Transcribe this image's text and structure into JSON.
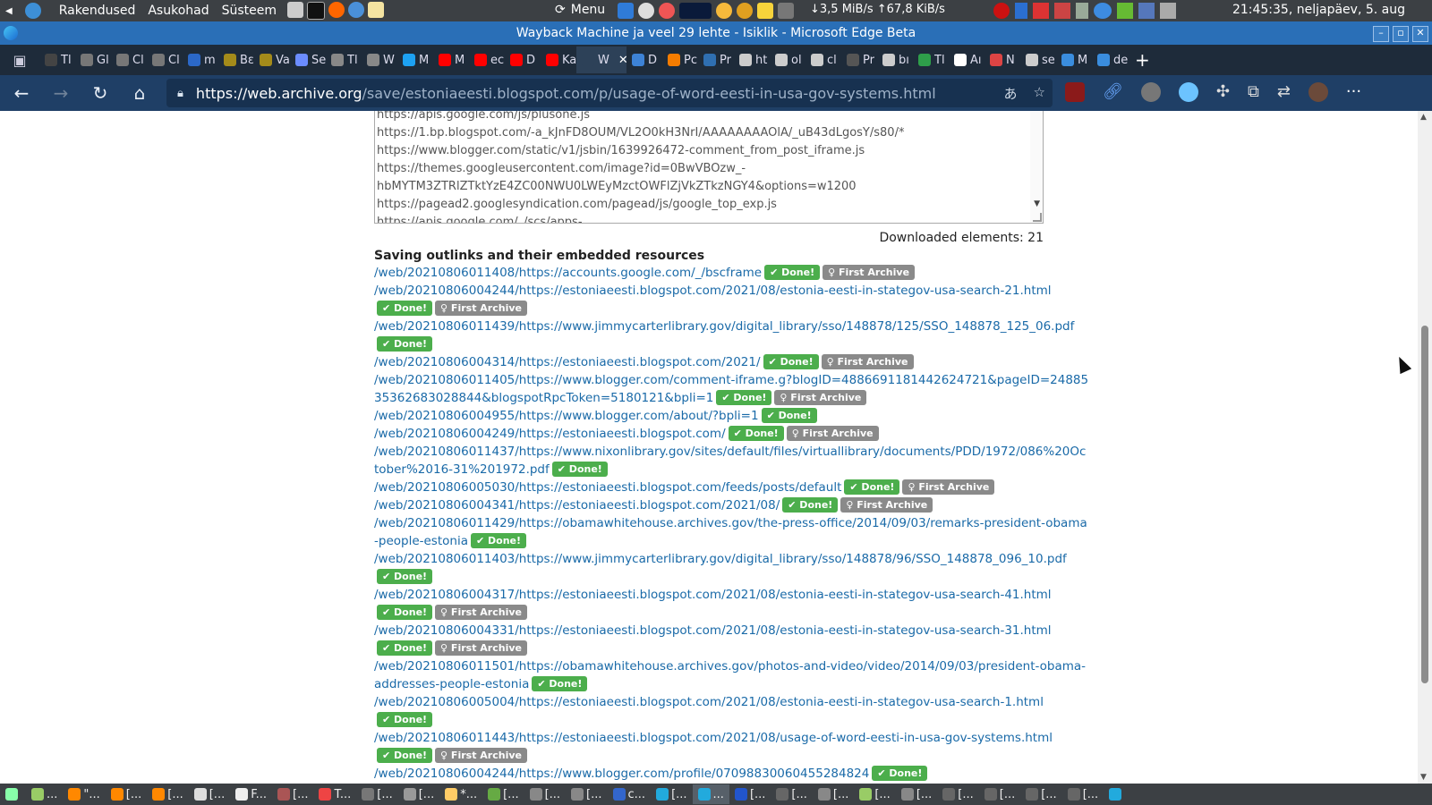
{
  "system_panel": {
    "menus": [
      "Rakendused",
      "Asukohad",
      "Süsteem"
    ],
    "menu_button": "Menu",
    "network_down": "3,5 MiB/s",
    "network_up": "67,8 KiB/s",
    "clock": "21:45:35, neljapäev,  5. aug"
  },
  "window": {
    "title": "Wayback Machine ja veel 29 lehte - Isiklik - Microsoft Edge Beta"
  },
  "tabs": [
    {
      "label": "Tl",
      "color": "#444"
    },
    {
      "label": "Gl",
      "color": "#777"
    },
    {
      "label": "Cl",
      "color": "#777"
    },
    {
      "label": "Cl",
      "color": "#777"
    },
    {
      "label": "m",
      "color": "#2b68c8"
    },
    {
      "label": "Bɛ",
      "color": "#a48b1a"
    },
    {
      "label": "Va",
      "color": "#a48b1a"
    },
    {
      "label": "Se",
      "color": "#6b8cff"
    },
    {
      "label": "Tl",
      "color": "#888"
    },
    {
      "label": "W",
      "color": "#888"
    },
    {
      "label": "M",
      "color": "#1da1f2"
    },
    {
      "label": "M",
      "color": "#ff0000"
    },
    {
      "label": "ec",
      "color": "#ff0000"
    },
    {
      "label": "D",
      "color": "#ff0000"
    },
    {
      "label": "Ka",
      "color": "#ff0000"
    },
    {
      "label": "W",
      "color": "#2d4158",
      "active": true
    },
    {
      "label": "D",
      "color": "#3d82d6"
    },
    {
      "label": "Pc",
      "color": "#f57c00"
    },
    {
      "label": "Pr",
      "color": "#2f6fb1"
    },
    {
      "label": "ht",
      "color": "#ccc"
    },
    {
      "label": "ol",
      "color": "#ccc"
    },
    {
      "label": "cl",
      "color": "#ccc"
    },
    {
      "label": "Pr",
      "color": "#555"
    },
    {
      "label": "bı",
      "color": "#ccc"
    },
    {
      "label": "Tl",
      "color": "#2e9e4a"
    },
    {
      "label": "Aı",
      "color": "#fff"
    },
    {
      "label": "N",
      "color": "#d44"
    },
    {
      "label": "se",
      "color": "#ccc"
    },
    {
      "label": "M",
      "color": "#3a8dde"
    },
    {
      "label": "de",
      "color": "#3a8dde"
    }
  ],
  "address_bar": {
    "url_host": "https://web.archive.org",
    "url_path": "/save/estoniaeesti.blogspot.com/p/usage-of-word-eesti-in-usa-gov-systems.html"
  },
  "resources_box": {
    "lines": [
      "https://apis.google.com/js/plusone.js",
      "https://1.bp.blogspot.com/-a_kJnFD8OUM/VL2O0kH3NrI/AAAAAAAAOlA/_uB43dLgosY/s80/*",
      "https://www.blogger.com/static/v1/jsbin/1639926472-comment_from_post_iframe.js",
      "https://themes.googleusercontent.com/image?id=0BwVBOzw_-",
      "hbMYTM3ZTRlZTktYzE4ZC00NWU0LWEyMzctOWFlZjVkZTkzNGY4&options=w1200",
      "https://pagead2.googlesyndication.com/pagead/js/google_top_exp.js",
      "https://apis.google.com/_/scs/apps-"
    ]
  },
  "downloaded_elements": "Downloaded elements: 21",
  "outlinks_heading": "Saving outlinks and their embedded resources",
  "badges": {
    "done": "Done!",
    "first": "First Archive"
  },
  "outlinks": [
    {
      "url": "/web/20210806011408/https://accounts.google.com/_/bscframe",
      "first": true
    },
    {
      "url": "/web/20210806004244/https://estoniaeesti.blogspot.com/2021/08/estonia-eesti-in-stategov-usa-search-21.html",
      "first": true
    },
    {
      "url": "/web/20210806011439/https://www.jimmycarterlibrary.gov/digital_library/sso/148878/125/SSO_148878_125_06.pdf",
      "first": false
    },
    {
      "url": "/web/20210806004314/https://estoniaeesti.blogspot.com/2021/",
      "first": true
    },
    {
      "url": "/web/20210806011405/https://www.blogger.com/comment-iframe.g?blogID=4886691181442624721&pageID=2488535362683028844&blogspotRpcToken=5180121&bpli=1",
      "first": true
    },
    {
      "url": "/web/20210806004955/https://www.blogger.com/about/?bpli=1",
      "first": false
    },
    {
      "url": "/web/20210806004249/https://estoniaeesti.blogspot.com/",
      "first": true
    },
    {
      "url": "/web/20210806011437/https://www.nixonlibrary.gov/sites/default/files/virtuallibrary/documents/PDD/1972/086%20October%2016-31%201972.pdf",
      "first": false
    },
    {
      "url": "/web/20210806005030/https://estoniaeesti.blogspot.com/feeds/posts/default",
      "first": true
    },
    {
      "url": "/web/20210806004341/https://estoniaeesti.blogspot.com/2021/08/",
      "first": true
    },
    {
      "url": "/web/20210806011429/https://obamawhitehouse.archives.gov/the-press-office/2014/09/03/remarks-president-obama-people-estonia",
      "first": false
    },
    {
      "url": "/web/20210806011403/https://www.jimmycarterlibrary.gov/digital_library/sso/148878/96/SSO_148878_096_10.pdf",
      "first": false
    },
    {
      "url": "/web/20210806004317/https://estoniaeesti.blogspot.com/2021/08/estonia-eesti-in-stategov-usa-search-41.html",
      "first": true
    },
    {
      "url": "/web/20210806004331/https://estoniaeesti.blogspot.com/2021/08/estonia-eesti-in-stategov-usa-search-31.html",
      "first": true
    },
    {
      "url": "/web/20210806011501/https://obamawhitehouse.archives.gov/photos-and-video/video/2014/09/03/president-obama-addresses-people-estonia",
      "first": false
    },
    {
      "url": "/web/20210806005004/https://estoniaeesti.blogspot.com/2021/08/estonia-eesti-in-stategov-usa-search-1.html",
      "first": false
    },
    {
      "url": "/web/20210806011443/https://estoniaeesti.blogspot.com/2021/08/usage-of-word-eesti-in-usa-gov-systems.html",
      "first": true
    },
    {
      "url": "/web/20210806004244/https://www.blogger.com/profile/07098830060455284824",
      "first": false
    }
  ],
  "taskbar": [
    {
      "label": "",
      "color": "#8fa"
    },
    {
      "label": "...",
      "color": "#9c6"
    },
    {
      "label": "\"...",
      "color": "#f80"
    },
    {
      "label": "[...",
      "color": "#f80"
    },
    {
      "label": "[...",
      "color": "#f80"
    },
    {
      "label": "[...",
      "color": "#ddd"
    },
    {
      "label": "F...",
      "color": "#eee"
    },
    {
      "label": "[...",
      "color": "#a55"
    },
    {
      "label": "T...",
      "color": "#e44"
    },
    {
      "label": "[...",
      "color": "#777"
    },
    {
      "label": "[...",
      "color": "#999"
    },
    {
      "label": "*...",
      "color": "#fc6"
    },
    {
      "label": "[...",
      "color": "#6a4"
    },
    {
      "label": "[...",
      "color": "#888"
    },
    {
      "label": "[...",
      "color": "#888"
    },
    {
      "label": "c...",
      "color": "#36c"
    },
    {
      "label": "[...",
      "color": "#2ad"
    },
    {
      "label": "...",
      "color": "#2ad",
      "active": true
    },
    {
      "label": "[...",
      "color": "#25c"
    },
    {
      "label": "[...",
      "color": "#666"
    },
    {
      "label": "[...",
      "color": "#888"
    },
    {
      "label": "[...",
      "color": "#9c6"
    },
    {
      "label": "[...",
      "color": "#888"
    },
    {
      "label": "[...",
      "color": "#666"
    },
    {
      "label": "[...",
      "color": "#666"
    },
    {
      "label": "[...",
      "color": "#666"
    },
    {
      "label": "[...",
      "color": "#666"
    },
    {
      "label": "",
      "color": "#2ad"
    }
  ]
}
